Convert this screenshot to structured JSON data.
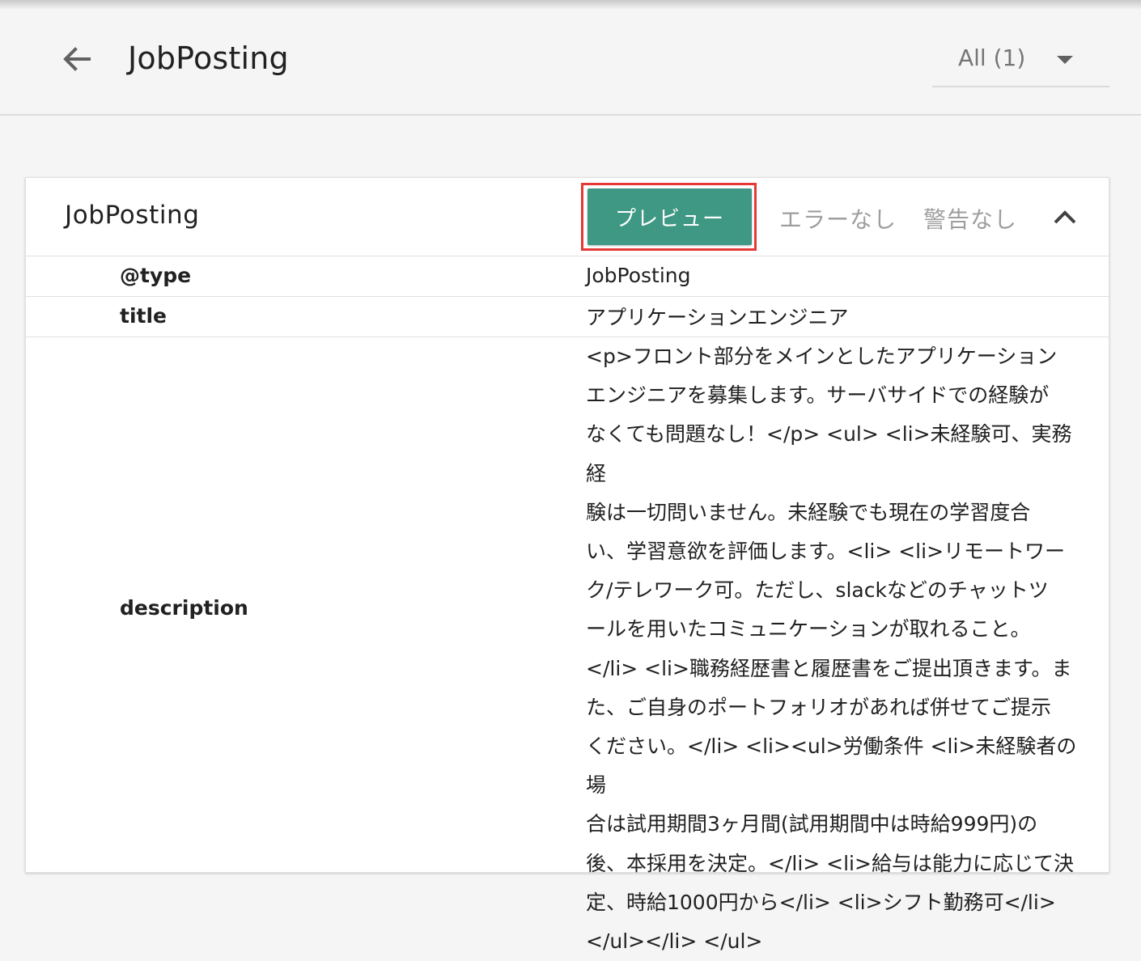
{
  "header": {
    "title": "JobPosting",
    "filter_label": "All (1)"
  },
  "card": {
    "title": "JobPosting",
    "preview_label": "プレビュー",
    "errors_label": "エラーなし",
    "warnings_label": "警告なし",
    "colors": {
      "preview_button": "#3f9884",
      "highlight_frame": "#e53935"
    }
  },
  "rows": [
    {
      "key": "@type",
      "value": "JobPosting"
    },
    {
      "key": "title",
      "value": "アプリケーションエンジニア"
    },
    {
      "key": "description",
      "value": "<p>フロント部分をメインとしたアプリケーション\nエンジニアを募集します。サーバサイドでの経験が\nなくても問題なし！</p> <ul> <li>未経験可、実務経\n験は一切問いません。未経験でも現在の学習度合\nい、学習意欲を評価します。<li> <li>リモートワー\nク/テレワーク可。ただし、slackなどのチャットツ\nールを用いたコミュニケーションが取れること。\n</li> <li>職務経歴書と履歴書をご提出頂きます。ま\nた、ご自身のポートフォリオがあれば併せてご提示\nください。</li> <li><ul>労働条件 <li>未経験者の場\n合は試用期間3ヶ月間(試用期間中は時給999円)の\n後、本採用を決定。</li> <li>給与は能力に応じて決\n定、時給1000円から</li> <li>シフト勤務可</li>\n</ul></li> </ul>"
    }
  ],
  "icons": {
    "back": "arrow-back-icon",
    "filter": "caret-down-icon",
    "collapse": "chevron-up-icon"
  }
}
